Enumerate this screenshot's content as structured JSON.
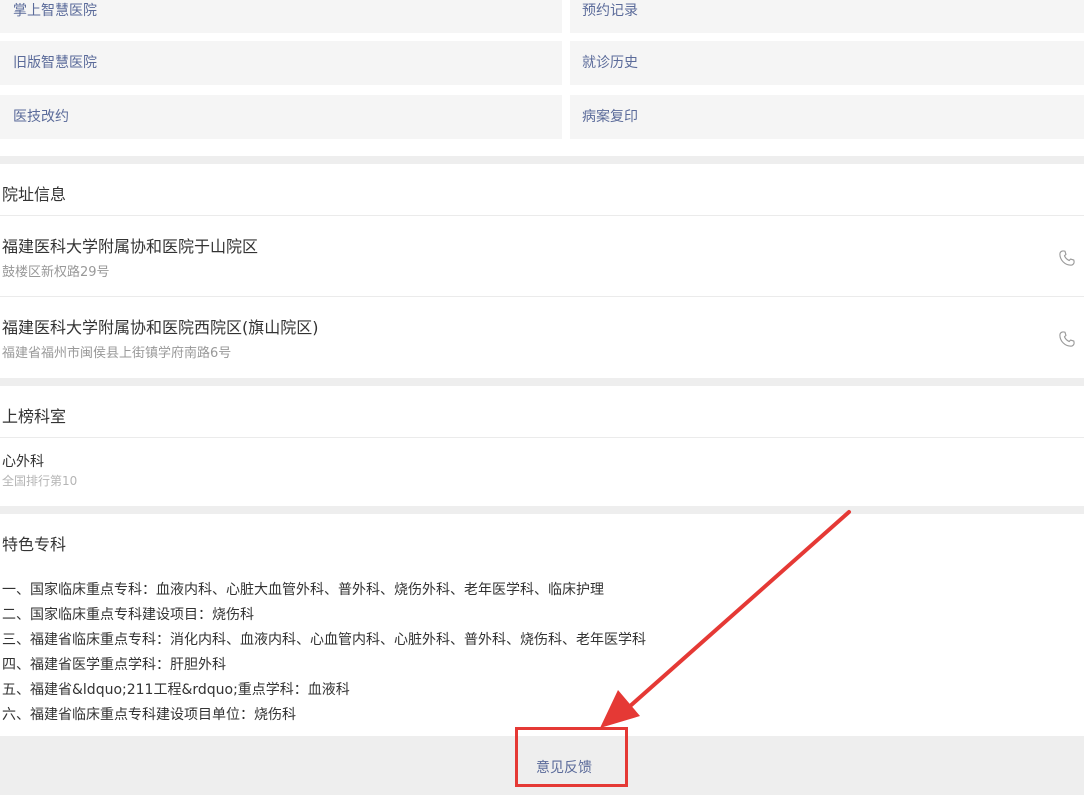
{
  "grid": {
    "items": [
      {
        "label": "掌上智慧医院"
      },
      {
        "label": "预约记录"
      },
      {
        "label": "旧版智慧医院"
      },
      {
        "label": "就诊历史"
      },
      {
        "label": "医技改约"
      },
      {
        "label": "病案复印"
      }
    ]
  },
  "address": {
    "title": "院址信息",
    "hospitals": [
      {
        "name": "福建医科大学附属协和医院于山院区",
        "addr": "鼓楼区新权路29号"
      },
      {
        "name": "福建医科大学附属协和医院西院区(旗山院区)",
        "addr": "福建省福州市闽侯县上街镇学府南路6号"
      }
    ]
  },
  "ranking": {
    "title": "上榜科室",
    "dept": "心外科",
    "rank": "全国排行第10"
  },
  "specialty": {
    "title": "特色专科",
    "lines": [
      "一、国家临床重点专科：血液内科、心脏大血管外科、普外科、烧伤外科、老年医学科、临床护理",
      "二、国家临床重点专科建设项目：烧伤科",
      "三、福建省临床重点专科：消化内科、血液内科、心血管内科、心脏外科、普外科、烧伤科、老年医学科",
      "四、福建省医学重点学科：肝胆外科",
      "五、福建省&ldquo;211工程&rdquo;重点学科：血液科",
      "六、福建省临床重点专科建设项目单位：烧伤科"
    ]
  },
  "footer": {
    "feedback_label": "意见反馈"
  },
  "colors": {
    "annotation": "#e53935",
    "link": "#5b6b9a"
  },
  "icons": {
    "phone": "phone-icon"
  }
}
